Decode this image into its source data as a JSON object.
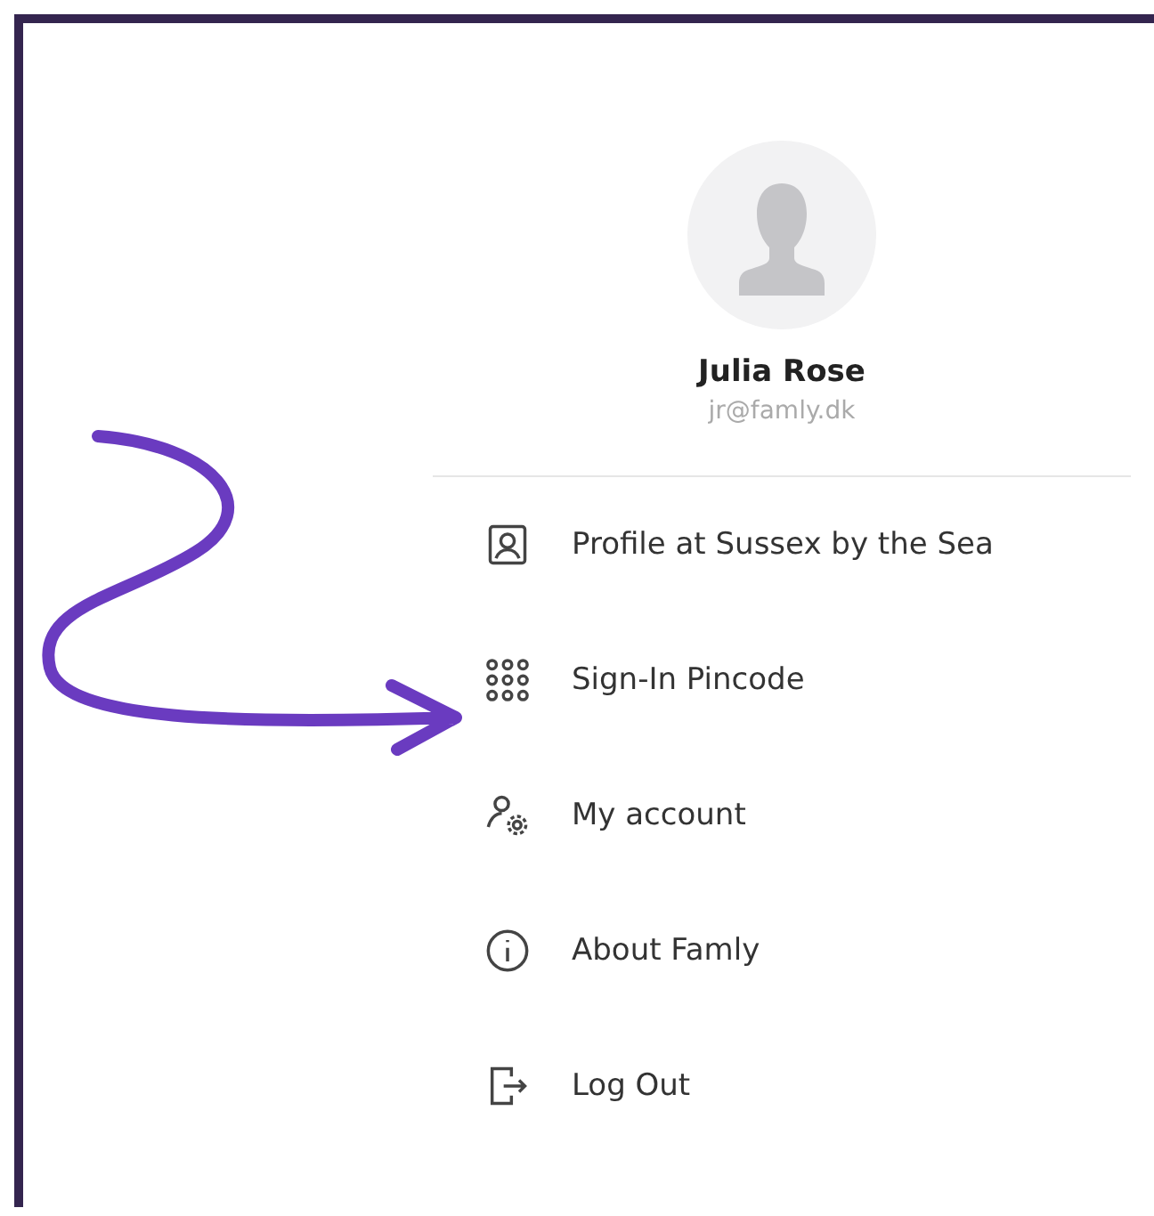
{
  "profile": {
    "name": "Julia Rose",
    "email": "jr@famly.dk"
  },
  "menu": [
    {
      "kind": "profile",
      "label": "Profile at Sussex by the Sea"
    },
    {
      "kind": "pincode",
      "label": "Sign-In Pincode"
    },
    {
      "kind": "account",
      "label": "My account"
    },
    {
      "kind": "about",
      "label": "About Famly"
    },
    {
      "kind": "logout",
      "label": "Log Out"
    }
  ]
}
